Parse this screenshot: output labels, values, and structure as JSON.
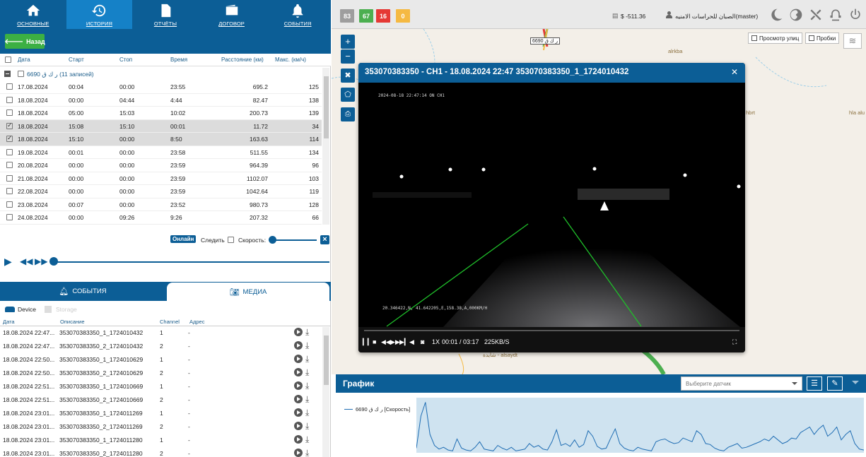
{
  "nav": {
    "items": [
      {
        "label": "ОСНОВНЫЕ",
        "icon": "home-icon"
      },
      {
        "label": "ИСТОРИЯ",
        "icon": "history-icon",
        "active": true
      },
      {
        "label": "ОТЧЁТЫ",
        "icon": "report-icon"
      },
      {
        "label": "ДОГОВОР",
        "icon": "wallet-icon"
      },
      {
        "label": "СОБЫТИЯ",
        "icon": "bell-icon"
      }
    ]
  },
  "back_label": "Назад",
  "trips": {
    "headers": {
      "date": "Дата",
      "start": "Старт",
      "stop": "Стоп",
      "time": "Время",
      "distance": "Расстояние (км)",
      "max_speed": "Макс. (км/ч)"
    },
    "group_label": "6690 ر ك ق (11 записей)",
    "rows": [
      {
        "date": "17.08.2024",
        "start": "00:04",
        "stop": "00:00",
        "time": "23:55",
        "distance": "695.2",
        "max": "125",
        "checked": false
      },
      {
        "date": "18.08.2024",
        "start": "00:00",
        "stop": "04:44",
        "time": "4:44",
        "distance": "82.47",
        "max": "138",
        "checked": false
      },
      {
        "date": "18.08.2024",
        "start": "05:00",
        "stop": "15:03",
        "time": "10:02",
        "distance": "200.73",
        "max": "139",
        "checked": false
      },
      {
        "date": "18.08.2024",
        "start": "15:08",
        "stop": "15:10",
        "time": "00:01",
        "distance": "11.72",
        "max": "34",
        "checked": true
      },
      {
        "date": "18.08.2024",
        "start": "15:10",
        "stop": "00:00",
        "time": "8:50",
        "distance": "163.63",
        "max": "114",
        "checked": true
      },
      {
        "date": "19.08.2024",
        "start": "00:01",
        "stop": "00:00",
        "time": "23:58",
        "distance": "511.55",
        "max": "134",
        "checked": false
      },
      {
        "date": "20.08.2024",
        "start": "00:00",
        "stop": "00:00",
        "time": "23:59",
        "distance": "964.39",
        "max": "96",
        "checked": false
      },
      {
        "date": "21.08.2024",
        "start": "00:00",
        "stop": "00:00",
        "time": "23:59",
        "distance": "1102.07",
        "max": "103",
        "checked": false
      },
      {
        "date": "22.08.2024",
        "start": "00:00",
        "stop": "00:00",
        "time": "23:59",
        "distance": "1042.64",
        "max": "119",
        "checked": false
      },
      {
        "date": "23.08.2024",
        "start": "00:07",
        "stop": "00:00",
        "time": "23:52",
        "distance": "980.73",
        "max": "128",
        "checked": false
      },
      {
        "date": "24.08.2024",
        "start": "00:00",
        "stop": "09:26",
        "time": "9:26",
        "distance": "207.32",
        "max": "66",
        "checked": false
      }
    ]
  },
  "controls": {
    "online": "Онлайн",
    "follow": "Следить",
    "speed": "Скорость:"
  },
  "bottom_tabs": {
    "events": "СОБЫТИЯ",
    "media": "МЕДИА"
  },
  "device": {
    "device_label": "Device",
    "storage_label": "Storage"
  },
  "media": {
    "headers": {
      "date": "Дата",
      "desc": "Описание",
      "channel": "Channel",
      "address": "Адрес"
    },
    "rows": [
      {
        "date": "18.08.2024 22:47...",
        "desc": "353070383350_1_1724010432",
        "channel": "1",
        "address": "-"
      },
      {
        "date": "18.08.2024 22:47...",
        "desc": "353070383350_2_1724010432",
        "channel": "2",
        "address": "-"
      },
      {
        "date": "18.08.2024 22:50...",
        "desc": "353070383350_1_1724010629",
        "channel": "1",
        "address": "-"
      },
      {
        "date": "18.08.2024 22:50...",
        "desc": "353070383350_2_1724010629",
        "channel": "2",
        "address": "-"
      },
      {
        "date": "18.08.2024 22:51...",
        "desc": "353070383350_1_1724010669",
        "channel": "1",
        "address": "-"
      },
      {
        "date": "18.08.2024 22:51...",
        "desc": "353070383350_2_1724010669",
        "channel": "2",
        "address": "-"
      },
      {
        "date": "18.08.2024 23:01...",
        "desc": "353070383350_1_1724011269",
        "channel": "1",
        "address": "-"
      },
      {
        "date": "18.08.2024 23:01...",
        "desc": "353070383350_2_1724011269",
        "channel": "2",
        "address": "-"
      },
      {
        "date": "18.08.2024 23:01...",
        "desc": "353070383350_1_1724011280",
        "channel": "1",
        "address": "-"
      },
      {
        "date": "18.08.2024 23:01...",
        "desc": "353070383350_2_1724011280",
        "channel": "2",
        "address": "-"
      }
    ]
  },
  "topbar": {
    "badges": [
      {
        "value": "83",
        "color": "#9e9e9e"
      },
      {
        "value": "67",
        "color": "#4caf50"
      },
      {
        "value": "16",
        "color": "#e53935"
      },
      {
        "value": "0",
        "color": "#f5b942"
      }
    ],
    "balance": "$ -511.36",
    "user": "الصبان للحراسات الامنيه(master)"
  },
  "map": {
    "street_view": "Просмотр улиц",
    "traffic": "Пробки",
    "plate_label": "6690 ر ك ق",
    "labels": [
      "alrkba",
      "hbrt",
      "hla alu",
      "شايدة - alsaydt"
    ]
  },
  "video": {
    "title": "353070383350 - CH1 - 18.08.2024 22:47 353070383350_1_1724010432",
    "osd_top": "2024-08-18 22:47:14 ON  CH1",
    "osd_bottom": "20.346422,N,   41.642205,E,158.38,A,000KM/H",
    "speed": "1X",
    "time": "00:01 / 03:17",
    "bitrate": "225KB/S"
  },
  "graph": {
    "title": "График",
    "sensor_placeholder": "Выберите датчик",
    "legend": "6690 ر ك ق [Скорость]"
  },
  "chart_data": {
    "type": "area",
    "series": [
      {
        "name": "6690 ر ك ق [Скорость]",
        "values": [
          5,
          40,
          55,
          20,
          8,
          4,
          6,
          3,
          2,
          15,
          5,
          3,
          2,
          6,
          12,
          4,
          3,
          2,
          8,
          5,
          3,
          6,
          2,
          3,
          4,
          10,
          6,
          8,
          4,
          3,
          12,
          25,
          8,
          10,
          7,
          14,
          6,
          9,
          24,
          18,
          7,
          4,
          5,
          16,
          26,
          10,
          5,
          3,
          2,
          6,
          4,
          3,
          2,
          12,
          14,
          15,
          12,
          10,
          11,
          16,
          14,
          12,
          24,
          20,
          10,
          9,
          5,
          3,
          2,
          6,
          8,
          10,
          5,
          6,
          8,
          10,
          12,
          15,
          13,
          18,
          14,
          10,
          12,
          16,
          15,
          22,
          25,
          28,
          20,
          26,
          30,
          18,
          22,
          28,
          14,
          20,
          24,
          10,
          4,
          3
        ]
      }
    ]
  }
}
